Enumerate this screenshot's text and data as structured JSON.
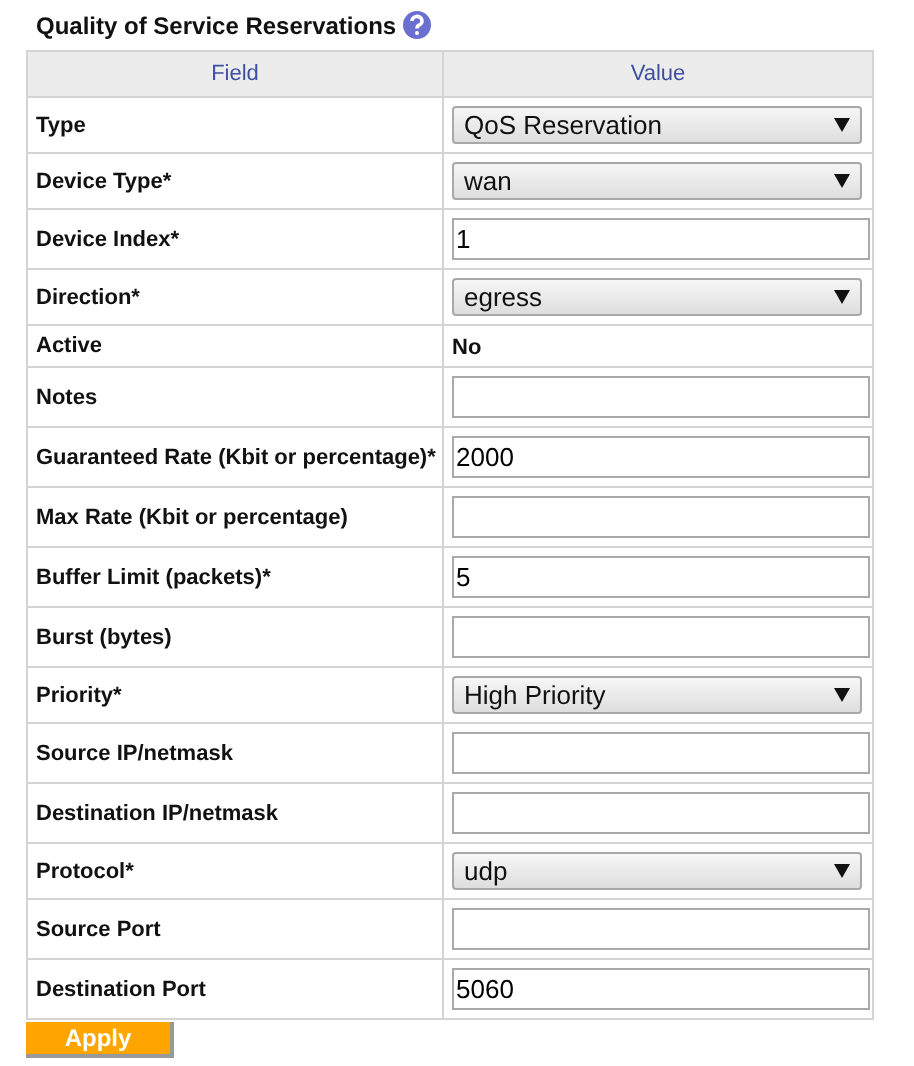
{
  "title": "Quality of Service Reservations",
  "table": {
    "columns": [
      "Field",
      "Value"
    ],
    "rows": [
      {
        "label": "Type",
        "kind": "select",
        "value": "QoS Reservation"
      },
      {
        "label": "Device Type*",
        "kind": "select",
        "value": "wan"
      },
      {
        "label": "Device Index*",
        "kind": "input",
        "value": "1"
      },
      {
        "label": "Direction*",
        "kind": "select",
        "value": "egress"
      },
      {
        "label": "Active",
        "kind": "text",
        "value": "No"
      },
      {
        "label": "Notes",
        "kind": "input"
      },
      {
        "label": "Guaranteed Rate (Kbit or percentage)*",
        "kind": "input",
        "value": "2000"
      },
      {
        "label": "Max Rate (Kbit or percentage)",
        "kind": "input"
      },
      {
        "label": "Buffer Limit (packets)*",
        "kind": "input",
        "value": "5"
      },
      {
        "label": "Burst (bytes)",
        "kind": "input"
      },
      {
        "label": "Priority*",
        "kind": "select",
        "value": "High Priority"
      },
      {
        "label": "Source IP/netmask",
        "kind": "input"
      },
      {
        "label": "Destination IP/netmask",
        "kind": "input"
      },
      {
        "label": "Protocol*",
        "kind": "select",
        "value": "udp"
      },
      {
        "label": "Source Port",
        "kind": "input"
      },
      {
        "label": "Destination Port",
        "kind": "input",
        "value": "5060"
      }
    ]
  },
  "button": "Apply"
}
